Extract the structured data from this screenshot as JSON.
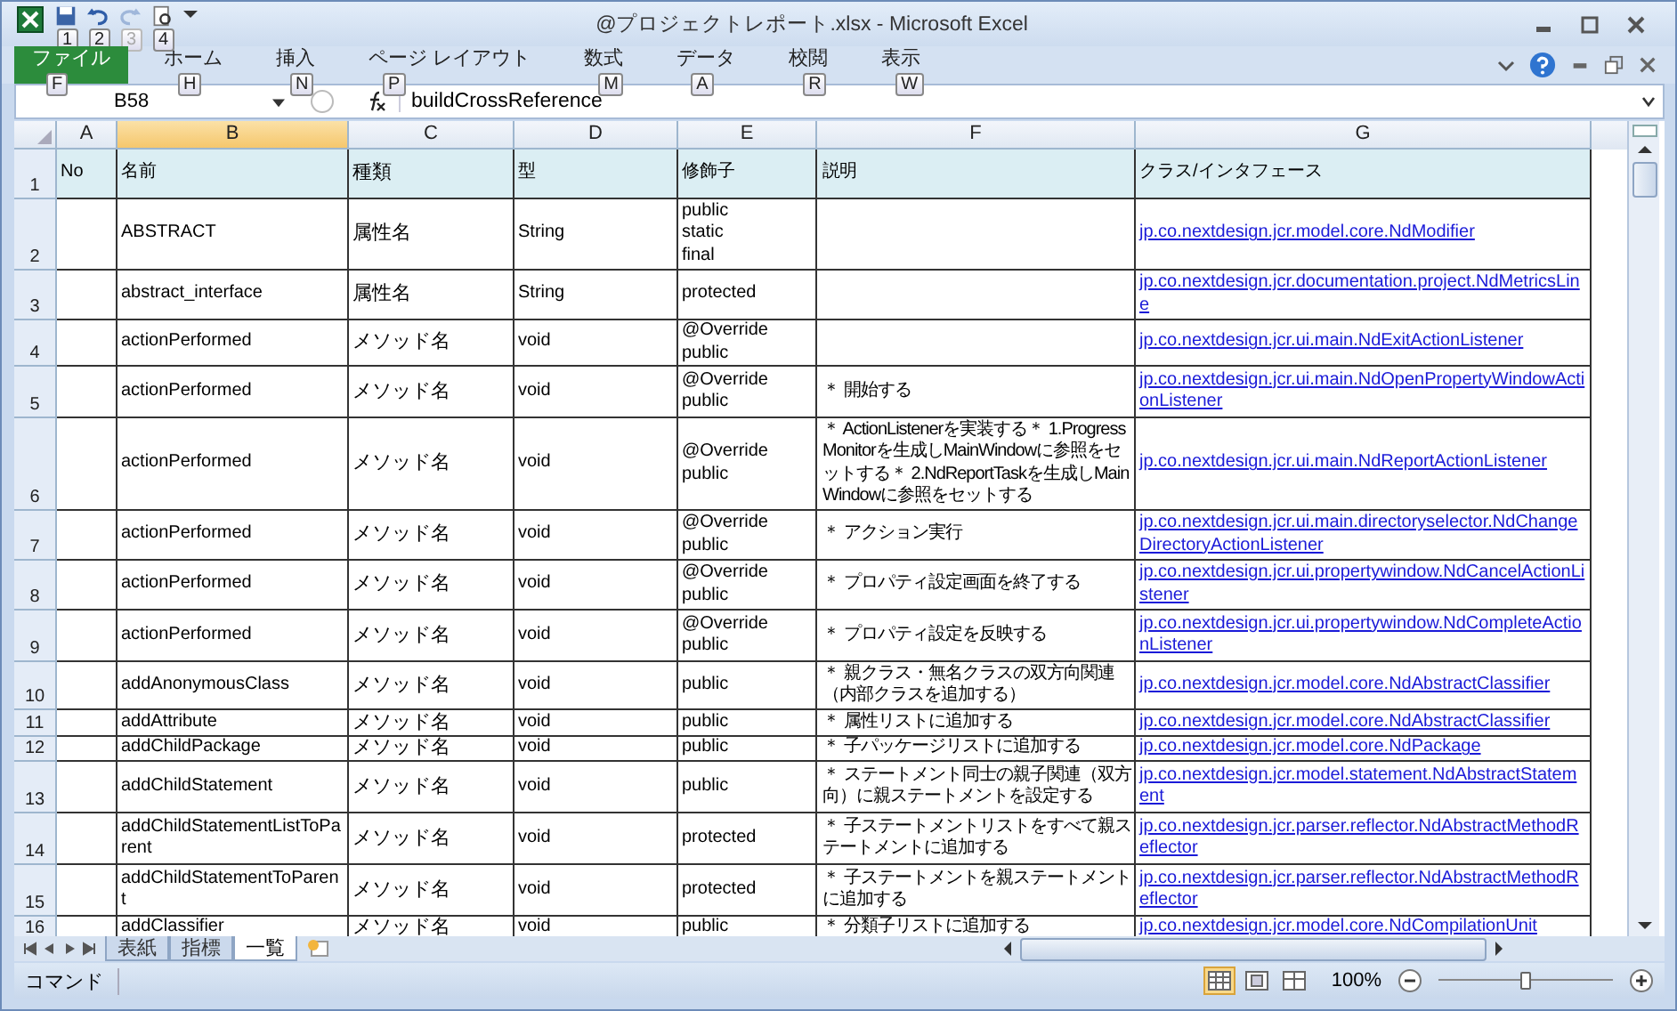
{
  "window": {
    "title": "@プロジェクトレポート.xlsx - Microsoft Excel"
  },
  "quick_access": [
    {
      "kind": "save",
      "keytip": "1",
      "disabled": false
    },
    {
      "kind": "undo",
      "keytip": "2",
      "disabled": false
    },
    {
      "kind": "redo",
      "keytip": "3",
      "disabled": true
    },
    {
      "kind": "preview",
      "keytip": "4",
      "disabled": false
    }
  ],
  "ribbon_tabs": [
    {
      "label": "ファイル",
      "keytip": "F",
      "selected": true
    },
    {
      "label": "ホーム",
      "keytip": "H",
      "selected": false
    },
    {
      "label": "挿入",
      "keytip": "N",
      "selected": false
    },
    {
      "label": "ページ レイアウト",
      "keytip": "P",
      "selected": false
    },
    {
      "label": "数式",
      "keytip": "M",
      "selected": false
    },
    {
      "label": "データ",
      "keytip": "A",
      "selected": false
    },
    {
      "label": "校閲",
      "keytip": "R",
      "selected": false
    },
    {
      "label": "表示",
      "keytip": "W",
      "selected": false
    }
  ],
  "name_box": "B58",
  "formula": "buildCrossReference",
  "columns": [
    {
      "letter": "A",
      "selected": false
    },
    {
      "letter": "B",
      "selected": true
    },
    {
      "letter": "C",
      "selected": false
    },
    {
      "letter": "D",
      "selected": false
    },
    {
      "letter": "E",
      "selected": false
    },
    {
      "letter": "F",
      "selected": false
    },
    {
      "letter": "G",
      "selected": false
    }
  ],
  "rows": [
    {
      "number": "1",
      "kind": "header",
      "a": "No",
      "b": "名前",
      "c": "種類",
      "d": "型",
      "e": "修飾子",
      "f": "説明",
      "g": "クラス/インタフェース"
    },
    {
      "number": "2",
      "kind": "data",
      "b": "ABSTRACT",
      "c": "属性名",
      "d": "String",
      "e": "public\nstatic\nfinal",
      "g": "jp.co.nextdesign.jcr.model.core.NdModifier"
    },
    {
      "number": "3",
      "kind": "data",
      "b": "abstract_interface",
      "c": "属性名",
      "d": "String",
      "e": "protected",
      "g": "jp.co.nextdesign.jcr.documentation.project.NdMetricsLine"
    },
    {
      "number": "4",
      "kind": "data",
      "b": "actionPerformed",
      "c": "メソッド名",
      "d": "void",
      "e": "@Override\npublic",
      "g": "jp.co.nextdesign.jcr.ui.main.NdExitActionListener"
    },
    {
      "number": "5",
      "kind": "data",
      "b": "actionPerformed",
      "c": "メソッド名",
      "d": "void",
      "e": "@Override\npublic",
      "f": "＊ 開始する",
      "g": "jp.co.nextdesign.jcr.ui.main.NdOpenPropertyWindowActionListener"
    },
    {
      "number": "6",
      "kind": "data",
      "b": "actionPerformed",
      "c": "メソッド名",
      "d": "void",
      "e": "@Override\npublic",
      "f": "＊ ActionListenerを実装する＊ 1.ProgressMonitorを生成しMainWindowに参照をセットする＊ 2.NdReportTaskを生成しMainWindowに参照をセットする",
      "g": "jp.co.nextdesign.jcr.ui.main.NdReportActionListener"
    },
    {
      "number": "7",
      "kind": "data",
      "b": "actionPerformed",
      "c": "メソッド名",
      "d": "void",
      "e": "@Override\npublic",
      "f": "＊ アクション実行",
      "g": "jp.co.nextdesign.jcr.ui.main.directoryselector.NdChangeDirectoryActionListener"
    },
    {
      "number": "8",
      "kind": "data",
      "b": "actionPerformed",
      "c": "メソッド名",
      "d": "void",
      "e": "@Override\npublic",
      "f": "＊ プロパティ設定画面を終了する",
      "g": "jp.co.nextdesign.jcr.ui.propertywindow.NdCancelActionListener"
    },
    {
      "number": "9",
      "kind": "data",
      "b": "actionPerformed",
      "c": "メソッド名",
      "d": "void",
      "e": "@Override\npublic",
      "f": "＊ プロパティ設定を反映する",
      "g": "jp.co.nextdesign.jcr.ui.propertywindow.NdCompleteActionListener"
    },
    {
      "number": "10",
      "kind": "data",
      "b": "addAnonymousClass",
      "c": "メソッド名",
      "d": "void",
      "e": "public",
      "f": "＊ 親クラス・無名クラスの双方向関連（内部クラスを追加する）",
      "g": "jp.co.nextdesign.jcr.model.core.NdAbstractClassifier"
    },
    {
      "number": "11",
      "kind": "data",
      "b": "addAttribute",
      "c": "メソッド名",
      "d": "void",
      "e": "public",
      "f": "＊ 属性リストに追加する",
      "g": "jp.co.nextdesign.jcr.model.core.NdAbstractClassifier"
    },
    {
      "number": "12",
      "kind": "data",
      "b": "addChildPackage",
      "c": "メソッド名",
      "d": "void",
      "e": "public",
      "f": "＊ 子パッケージリストに追加する",
      "g": "jp.co.nextdesign.jcr.model.core.NdPackage"
    },
    {
      "number": "13",
      "kind": "data",
      "b": "addChildStatement",
      "c": "メソッド名",
      "d": "void",
      "e": "public",
      "f": "＊ ステートメント同士の親子関連（双方向）に親ステートメントを設定する",
      "g": "jp.co.nextdesign.jcr.model.statement.NdAbstractStatement"
    },
    {
      "number": "14",
      "kind": "data",
      "b": "addChildStatementListToParent",
      "c": "メソッド名",
      "d": "void",
      "e": "protected",
      "f": "＊ 子ステートメントリストをすべて親ステートメントに追加する",
      "g": "jp.co.nextdesign.jcr.parser.reflector.NdAbstractMethodReflector"
    },
    {
      "number": "15",
      "kind": "data",
      "b": "addChildStatementToParent",
      "c": "メソッド名",
      "d": "void",
      "e": "protected",
      "f": "＊ 子ステートメントを親ステートメントに追加する",
      "g": "jp.co.nextdesign.jcr.parser.reflector.NdAbstractMethodReflector"
    },
    {
      "number": "16",
      "kind": "data",
      "b": "addClassifier",
      "c": "メソッド名",
      "d": "void",
      "e": "public",
      "f": "＊ 分類子リストに追加する",
      "g": "jp.co.nextdesign.jcr.model.core.NdCompilationUnit"
    }
  ],
  "sheet_tabs": [
    {
      "label": "表紙",
      "selected": false
    },
    {
      "label": "指標",
      "selected": false
    },
    {
      "label": "一覧",
      "selected": true
    }
  ],
  "status_bar": {
    "mode": "コマンド",
    "views": [
      {
        "kind": "normal",
        "selected": true
      },
      {
        "kind": "page_layout",
        "selected": false
      },
      {
        "kind": "page_break",
        "selected": false
      }
    ],
    "zoom": "100%",
    "zoom_slider": {
      "level": 0.5
    }
  }
}
